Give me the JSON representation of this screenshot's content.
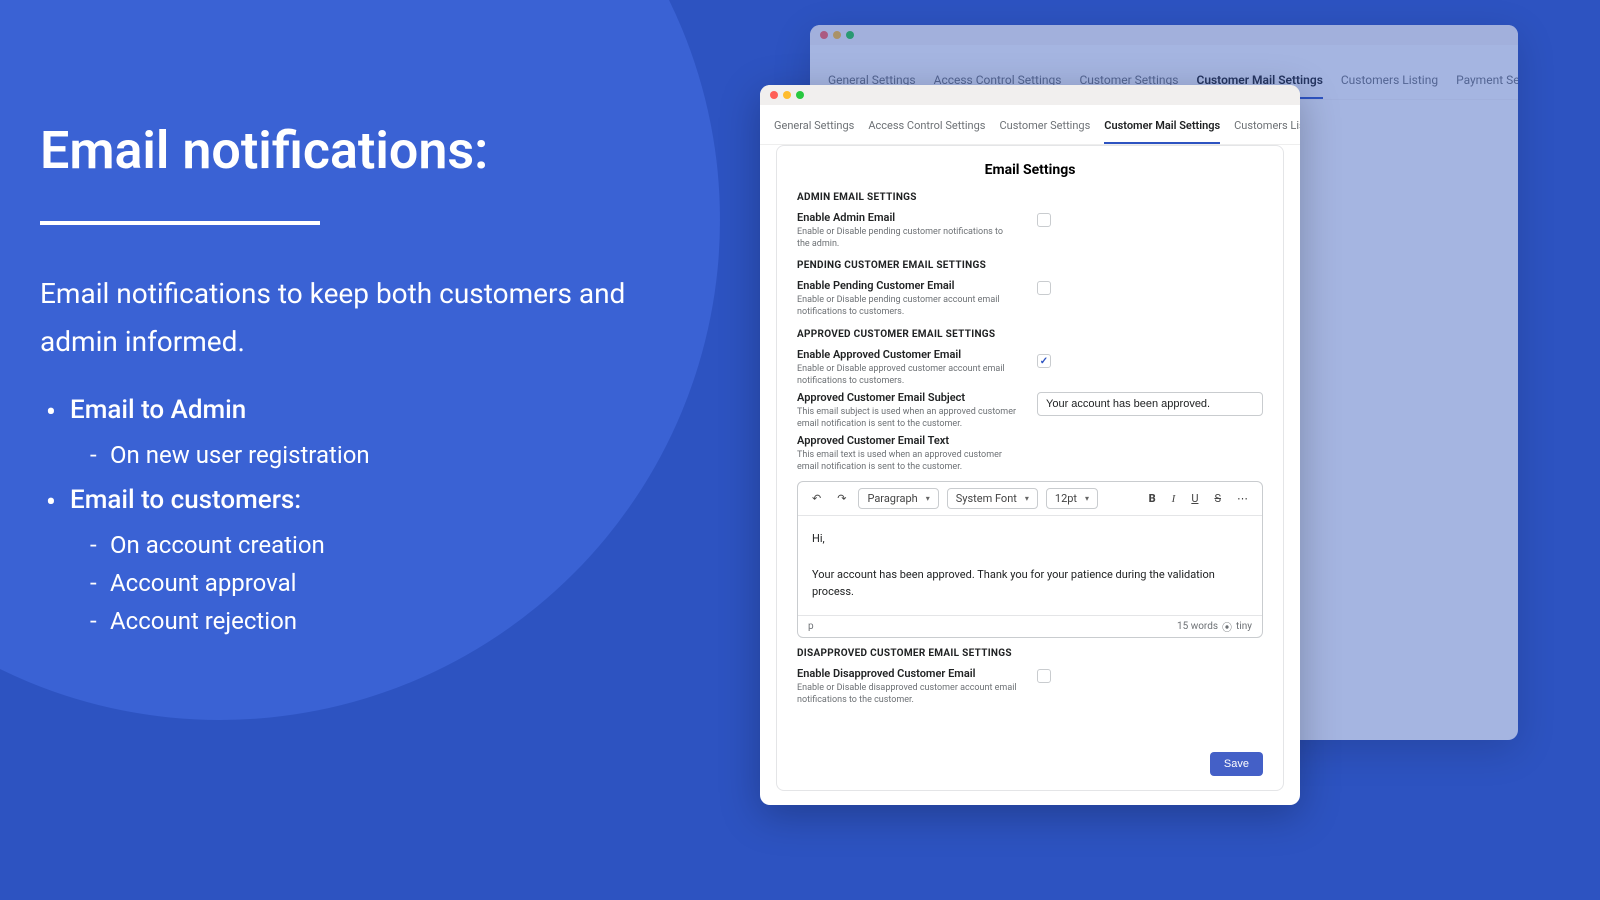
{
  "promo": {
    "title": "Email notifications:",
    "lead": "Email notifications to keep both customers and admin informed.",
    "b1": "Email to Admin",
    "b1_1": "On new user registration",
    "b2": "Email to customers:",
    "b2_1": "On account creation",
    "b2_2": "Account approval",
    "b2_3": "Account rejection"
  },
  "tabs": {
    "general": "General Settings",
    "access": "Access Control Settings",
    "customer": "Customer Settings",
    "mail": "Customer Mail Settings",
    "listing": "Customers Listing",
    "payment": "Payment Settings"
  },
  "card": {
    "title": "Email Settings",
    "admin": {
      "sec": "ADMIN EMAIL SETTINGS",
      "label": "Enable Admin Email",
      "help": "Enable or Disable pending customer notifications to the admin."
    },
    "pending": {
      "sec": "PENDING CUSTOMER EMAIL SETTINGS",
      "label": "Enable Pending Customer Email",
      "help": "Enable or Disable pending customer account email notifications to customers."
    },
    "approved": {
      "sec": "APPROVED CUSTOMER EMAIL SETTINGS",
      "enable_label": "Enable Approved Customer Email",
      "enable_help": "Enable or Disable approved customer account email notifications to customers.",
      "subject_label": "Approved Customer Email Subject",
      "subject_help": "This email subject is used when an approved customer email notification is sent to the customer.",
      "subject_value": "Your account has been approved.",
      "text_label": "Approved Customer Email Text",
      "text_help": "This email text is used when an approved customer email notification is sent to the customer."
    },
    "editor": {
      "paragraph": "Paragraph",
      "font": "System Font",
      "size": "12pt",
      "line1": "Hi,",
      "line2": "Your account has been approved. Thank you for your patience during the validation process.",
      "tag": "p",
      "words": "15 words",
      "tiny": "tiny"
    },
    "disapproved": {
      "sec": "DISAPPROVED CUSTOMER EMAIL SETTINGS",
      "label": "Enable Disapproved Customer Email",
      "help": "Enable or Disable disapproved customer account email notifications to the customer."
    },
    "save": "Save"
  }
}
